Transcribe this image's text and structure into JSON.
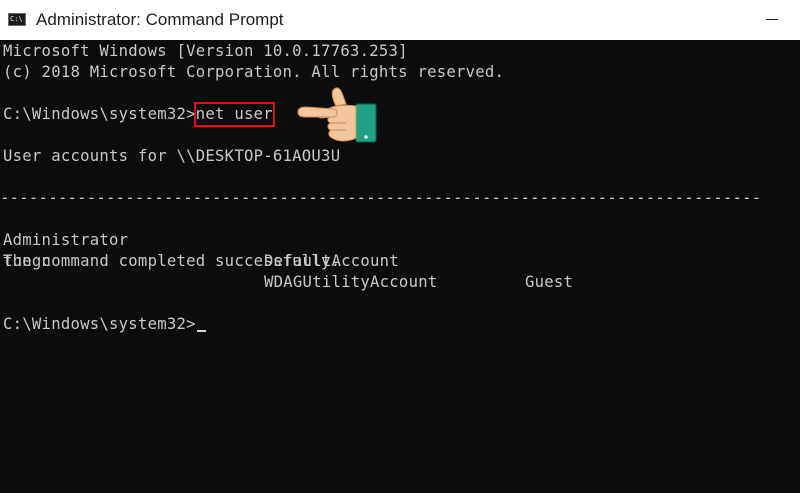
{
  "window": {
    "title": "Administrator: Command Prompt",
    "icon_label": "C:\\",
    "icon": "cmd-icon"
  },
  "console": {
    "header_line1": "Microsoft Windows [Version 10.0.17763.253]",
    "header_line2": "(c) 2018 Microsoft Corporation. All rights reserved.",
    "prompt1": "C:\\Windows\\system32>",
    "command": "net user",
    "accounts_header": "User accounts for \\\\DESKTOP-61AOU3U",
    "separator": "-------------------------------------------------------------------------------",
    "accounts": [
      [
        "Administrator",
        "DefaultAccount",
        "Guest"
      ],
      [
        "tungn",
        "WDAGUtilityAccount",
        ""
      ]
    ],
    "completed": "The command completed successfully.",
    "prompt2": "C:\\Windows\\system32>"
  },
  "colors": {
    "console_bg": "#0c0c0c",
    "console_text": "#c8c8c8",
    "highlight_border": "#e01010",
    "hand_skin": "#f3c79b",
    "sleeve": "#1ea184"
  },
  "overlay": {
    "icon": "pointing-hand-icon"
  }
}
